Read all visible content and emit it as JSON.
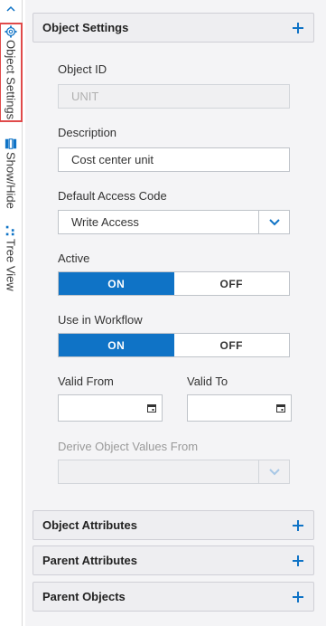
{
  "rail": {
    "object_settings_label": "Object Settings",
    "show_hide_label": "Show/Hide",
    "tree_view_label": "Tree View"
  },
  "sections": {
    "object_settings": "Object Settings",
    "object_attributes": "Object Attributes",
    "parent_attributes": "Parent Attributes",
    "parent_objects": "Parent Objects"
  },
  "form": {
    "object_id": {
      "label": "Object ID",
      "value": "UNIT"
    },
    "description": {
      "label": "Description",
      "value": "Cost center unit"
    },
    "default_access_code": {
      "label": "Default Access Code",
      "value": "Write Access"
    },
    "active": {
      "label": "Active",
      "on": "ON",
      "off": "OFF",
      "selected": "ON"
    },
    "use_in_workflow": {
      "label": "Use in Workflow",
      "on": "ON",
      "off": "OFF",
      "selected": "ON"
    },
    "valid_from": {
      "label": "Valid From",
      "value": ""
    },
    "valid_to": {
      "label": "Valid To",
      "value": ""
    },
    "derive_object_values_from": {
      "label": "Derive Object Values From",
      "value": ""
    }
  },
  "colors": {
    "accent": "#0f73c6",
    "highlight": "#e04a4a"
  }
}
